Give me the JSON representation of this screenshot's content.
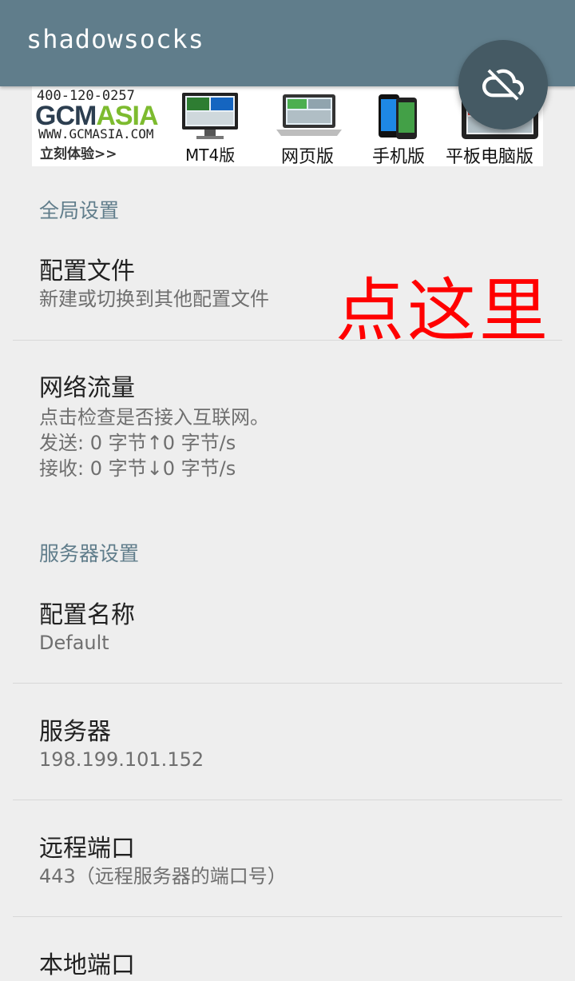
{
  "app": {
    "title": "shadowsocks",
    "fab_icon": "cloud-off-icon",
    "primary_color": "#607d8b",
    "fab_color": "#455a64"
  },
  "ad": {
    "phone": "400-120-0257",
    "logo_gcm": "GCM",
    "logo_asia": "ASIA",
    "url": "WWW.GCMASIA.COM",
    "cta": "立刻体验>>",
    "platforms": [
      {
        "label": "MT4版",
        "icon": "monitor-icon"
      },
      {
        "label": "网页版",
        "icon": "laptop-icon"
      },
      {
        "label": "手机版",
        "icon": "phone-icon"
      },
      {
        "label": "平板电脑版",
        "icon": "tablet-icon"
      }
    ]
  },
  "global_settings": {
    "header": "全局设置",
    "profile": {
      "title": "配置文件",
      "summary": "新建或切换到其他配置文件"
    },
    "traffic": {
      "title": "网络流量",
      "line1": "点击检查是否接入互联网。",
      "line2": "发送:  0 字节↑0 字节/s",
      "line3": "接收:  0 字节↓0 字节/s"
    }
  },
  "annotation": {
    "text": "点这里",
    "color": "#ff0000"
  },
  "server_settings": {
    "header": "服务器设置",
    "profile_name": {
      "title": "配置名称",
      "value": "Default"
    },
    "server": {
      "title": "服务器",
      "value": "198.199.101.152"
    },
    "remote_port": {
      "title": "远程端口",
      "value": "443（远程服务器的端口号）"
    },
    "local_port": {
      "title": "本地端口"
    }
  }
}
